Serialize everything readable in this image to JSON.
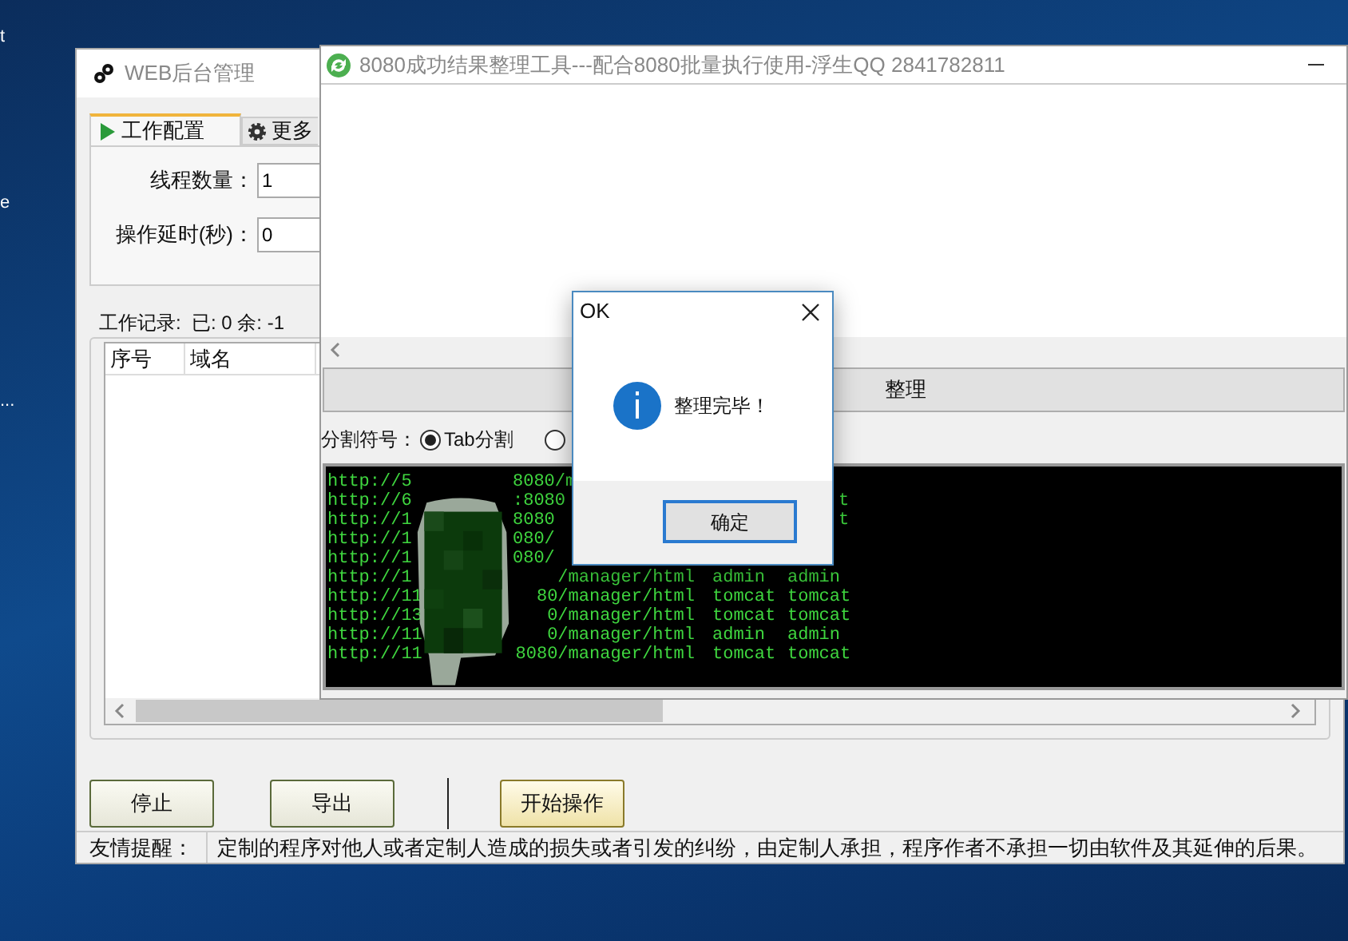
{
  "desktop": {
    "icon_labels": [
      "t",
      "e",
      "..."
    ]
  },
  "main_window": {
    "title": "WEB后台管理",
    "tabs": [
      {
        "label": "工作配置",
        "selected": true
      },
      {
        "label": "更多",
        "selected": false
      }
    ],
    "fields": [
      {
        "label": "线程数量：",
        "value": "1"
      },
      {
        "label": "操作延时(秒)：",
        "value": "0"
      }
    ],
    "work_log": {
      "title": "工作记录:  已: 0 余: -1"
    },
    "table": {
      "columns": [
        "序号",
        "域名"
      ]
    },
    "buttons": [
      {
        "label": "停止",
        "kind": "plain"
      },
      {
        "label": "导出",
        "kind": "plain"
      },
      {
        "label": "开始操作",
        "kind": "primary"
      }
    ],
    "status_bar": {
      "label": "友情提醒：",
      "message": "定制的程序对他人或者定制人造成的损失或者引发的纠纷，由定制人承担，程序作者不承担一切由软件及其延伸的后果。"
    }
  },
  "tool_window": {
    "title": "8080成功结果整理工具---配合8080批量执行使用-浮生QQ 2841782811",
    "action_button": "整理",
    "separator": {
      "label": "分割符号：",
      "options": [
        {
          "label": "Tab分割",
          "selected": true
        },
        {
          "selected": false
        }
      ]
    },
    "output_lines": [
      {
        "start": "http://5",
        "end": "8080/m"
      },
      {
        "start": "http://6",
        "end": ":8080",
        "password": "t"
      },
      {
        "start": "http://1",
        "end": "8080",
        "password": "t"
      },
      {
        "start": "http://1",
        "end": "080/"
      },
      {
        "start": "http://1",
        "end": "080/"
      },
      {
        "start": "http://1",
        "end": "/manager/html",
        "user": "admin",
        "password": "admin"
      },
      {
        "start": "http://11",
        "end": "80/manager/html",
        "user": "tomcat",
        "password": "tomcat"
      },
      {
        "start": "http://13",
        "end": "0/manager/html",
        "user": "tomcat",
        "password": "tomcat"
      },
      {
        "start": "http://11",
        "end": "0/manager/html",
        "user": "admin",
        "password": "admin"
      },
      {
        "start": "http://11",
        "end": "8080/manager/html",
        "user": "tomcat",
        "password": "tomcat"
      }
    ]
  },
  "dialog": {
    "title": "OK",
    "message": "整理完毕！",
    "button": "确定"
  }
}
